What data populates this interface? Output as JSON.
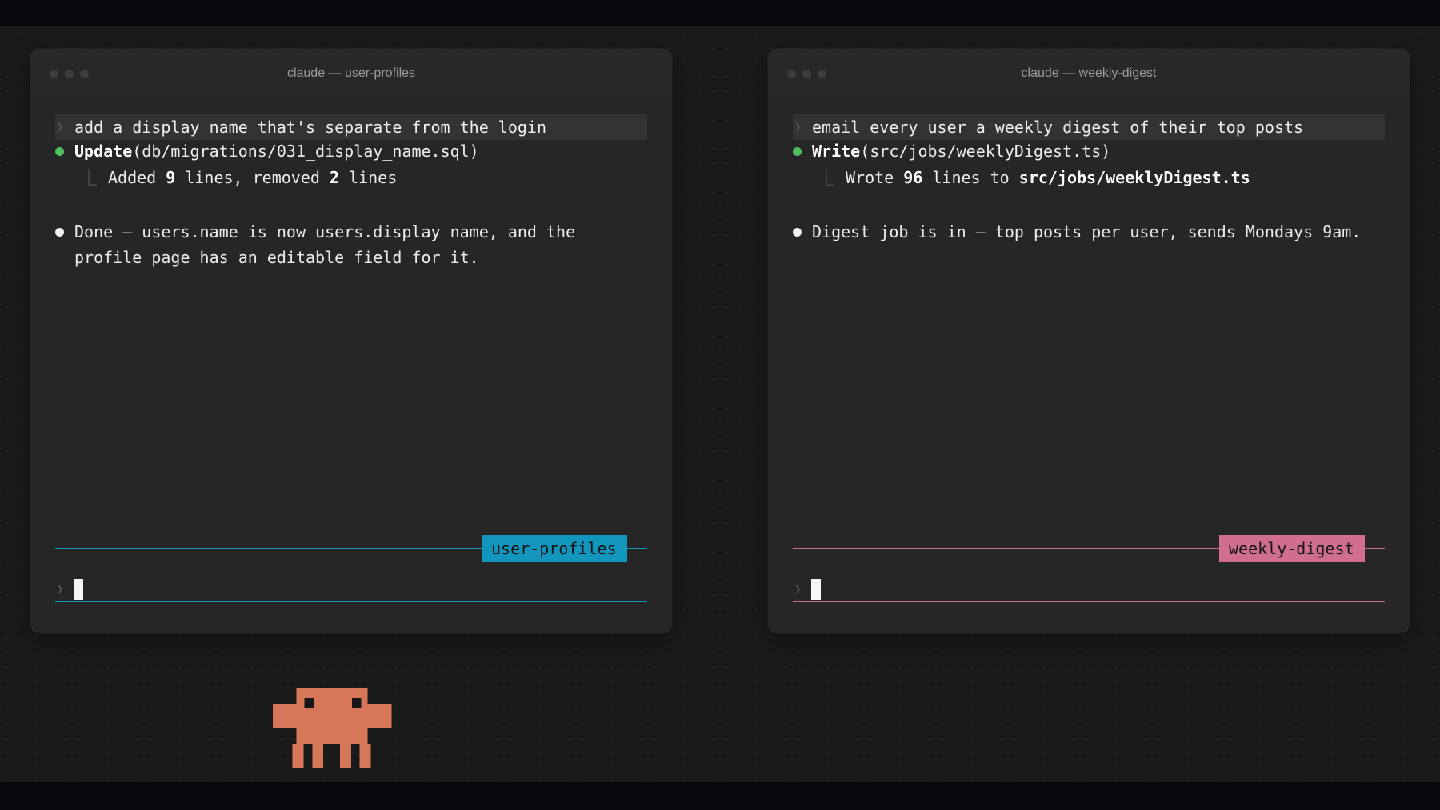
{
  "colors": {
    "background": "#1a1a1b",
    "window": "#262627",
    "accent_blue": "#1296be",
    "accent_pink": "#cf6e8d",
    "success_green": "#4fbf5f",
    "mascot": "#d7775a"
  },
  "windows": [
    {
      "title": "claude — user-profiles",
      "prompt_icon": "chevron-right-icon",
      "prompt": "add a display name that's separate from the login",
      "tool_call": {
        "name": "Update",
        "args": "(db/migrations/031_display_name.sql)",
        "result_prefix": "Added ",
        "result_num1": "9",
        "result_mid": " lines, removed ",
        "result_num2": "2",
        "result_suffix": " lines"
      },
      "message_line1": "Done — users.name is now users.display_name, and the",
      "message_line2": "profile page has an editable field for it.",
      "branch": "user-profiles"
    },
    {
      "title": "claude — weekly-digest",
      "prompt_icon": "chevron-right-icon",
      "prompt": "email every user a weekly digest of their top posts",
      "tool_call": {
        "name": "Write",
        "args": "(src/jobs/weeklyDigest.ts)",
        "result_prefix": "Wrote ",
        "result_num": "96",
        "result_mid": " lines to ",
        "result_path": "src/jobs/weeklyDigest.ts"
      },
      "message_line1": "Digest job is in — top posts per user, sends Mondays 9am.",
      "branch": "weekly-digest"
    }
  ],
  "mascot_icon": "pixel-creature-icon"
}
